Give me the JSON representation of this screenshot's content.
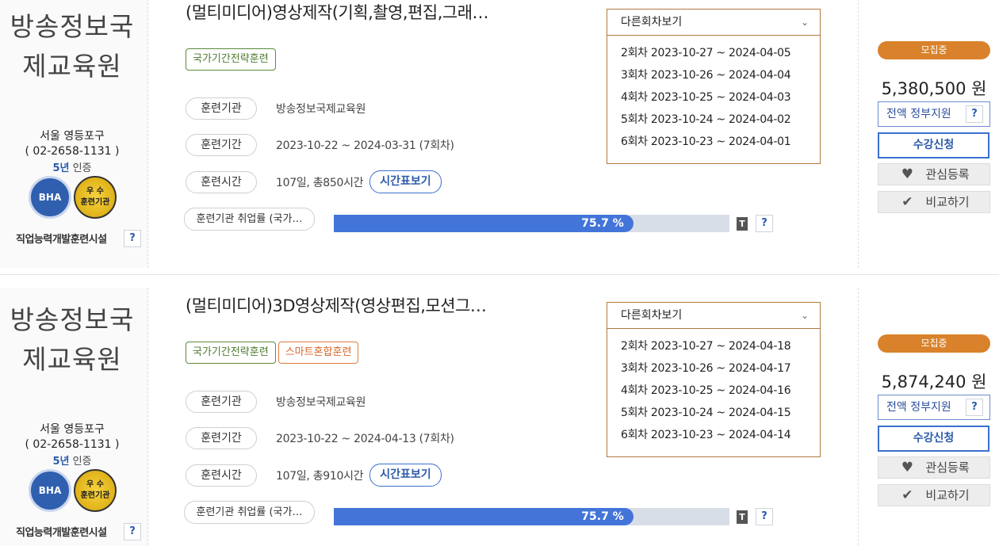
{
  "courses": [
    {
      "org": {
        "name_line1": "방송정보국",
        "name_line2": "제교육원",
        "location": "서울 영등포구",
        "phone": "( 02-2658-1131 )",
        "cert_years": "5년",
        "cert_suffix": " 인증",
        "badge_bha": "BHA",
        "badge_top_line1": "우 수",
        "badge_top_line2": "훈련기관",
        "facility": "직업능력개발훈련시설",
        "help": "?"
      },
      "title": "(멀티미디어)영상제작(기획,촬영,편집,그래…",
      "tags": [
        "국가기간전략훈련"
      ],
      "info": {
        "inst_label": "훈련기관",
        "inst_value": "방송정보국제교육원",
        "period_label": "훈련기간",
        "period_value": "2023-10-22 ~ 2024-03-31 (7회차)",
        "hours_label": "훈련시간",
        "hours_value": "107일, 총850시간",
        "timetable_button": "시간표보기"
      },
      "employment": {
        "label": "훈련기관 취업률 (국가…",
        "rate": 75.7,
        "rate_text": "75.7 %",
        "t_icon": "T",
        "help": "?"
      },
      "sessions": {
        "header": "다른회차보기",
        "items": [
          "2회차 2023-10-27 ~ 2024-04-05",
          "3회차 2023-10-26 ~ 2024-04-04",
          "4회차 2023-10-25 ~ 2024-04-03",
          "5회차 2023-10-24 ~ 2024-04-02",
          "6회차 2023-10-23 ~ 2024-04-01"
        ]
      },
      "side": {
        "status": "모집중",
        "price": "5,380,500 원",
        "support": "전액 정부지원",
        "support_help": "?",
        "apply": "수강신청",
        "like": "관심등록",
        "compare": "비교하기"
      }
    },
    {
      "org": {
        "name_line1": "방송정보국",
        "name_line2": "제교육원",
        "location": "서울 영등포구",
        "phone": "( 02-2658-1131 )",
        "cert_years": "5년",
        "cert_suffix": " 인증",
        "badge_bha": "BHA",
        "badge_top_line1": "우 수",
        "badge_top_line2": "훈련기관",
        "facility": "직업능력개발훈련시설",
        "help": "?"
      },
      "title": "(멀티미디어)3D영상제작(영상편집,모션그…",
      "tags": [
        "국가기간전략훈련",
        "스마트혼합훈련"
      ],
      "info": {
        "inst_label": "훈련기관",
        "inst_value": "방송정보국제교육원",
        "period_label": "훈련기간",
        "period_value": "2023-10-22 ~ 2024-04-13 (7회차)",
        "hours_label": "훈련시간",
        "hours_value": "107일, 총910시간",
        "timetable_button": "시간표보기"
      },
      "employment": {
        "label": "훈련기관 취업률 (국가…",
        "rate": 75.7,
        "rate_text": "75.7 %",
        "t_icon": "T",
        "help": "?"
      },
      "sessions": {
        "header": "다른회차보기",
        "items": [
          "2회차 2023-10-27 ~ 2024-04-18",
          "3회차 2023-10-26 ~ 2024-04-17",
          "4회차 2023-10-25 ~ 2024-04-16",
          "5회차 2023-10-24 ~ 2024-04-15",
          "6회차 2023-10-23 ~ 2024-04-14"
        ]
      },
      "side": {
        "status": "모집중",
        "price": "5,874,240 원",
        "support": "전액 정부지원",
        "support_help": "?",
        "apply": "수강신청",
        "like": "관심등록",
        "compare": "비교하기"
      }
    }
  ]
}
